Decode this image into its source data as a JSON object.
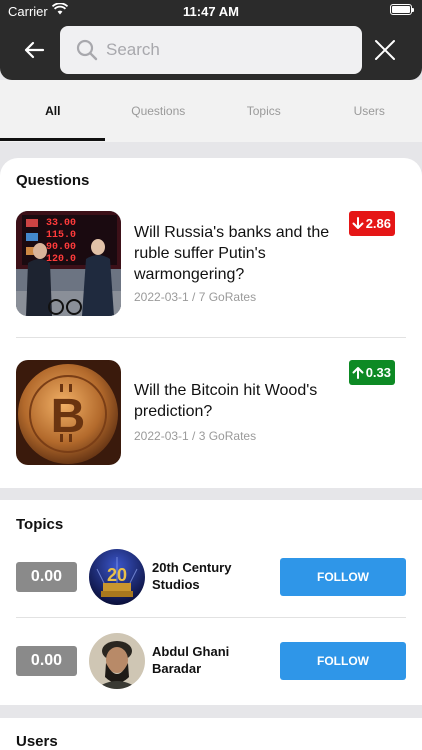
{
  "status_bar": {
    "carrier": "Carrier",
    "time": "11:47 AM"
  },
  "search": {
    "placeholder": "Search",
    "value": ""
  },
  "tabs": [
    {
      "label": "All",
      "active": true
    },
    {
      "label": "Questions",
      "active": false
    },
    {
      "label": "Topics",
      "active": false
    },
    {
      "label": "Users",
      "active": false
    }
  ],
  "questions_section": {
    "title": "Questions",
    "items": [
      {
        "title": "Will Russia's banks and the ruble suffer Putin's warmongering?",
        "meta": "2022-03-1 / 7 GoRates",
        "change": "2.86",
        "direction": "down",
        "thumbnail": "currency-exchange-board-photo"
      },
      {
        "title": "Will the Bitcoin hit Wood's prediction?",
        "meta": "2022-03-1 / 3 GoRates",
        "change": "0.33",
        "direction": "up",
        "thumbnail": "bitcoin-coin-photo"
      }
    ]
  },
  "topics_section": {
    "title": "Topics",
    "items": [
      {
        "score": "0.00",
        "name": "20th Century Studios",
        "button": "FOLLOW",
        "avatar": "20th-century-logo"
      },
      {
        "score": "0.00",
        "name": "Abdul Ghani Baradar",
        "button": "FOLLOW",
        "avatar": "person-photo"
      }
    ]
  },
  "users_section": {
    "title": "Users"
  },
  "colors": {
    "down": "#e51616",
    "up": "#0d8a24",
    "follow": "#2f96e8",
    "header": "#2b2b2b"
  }
}
